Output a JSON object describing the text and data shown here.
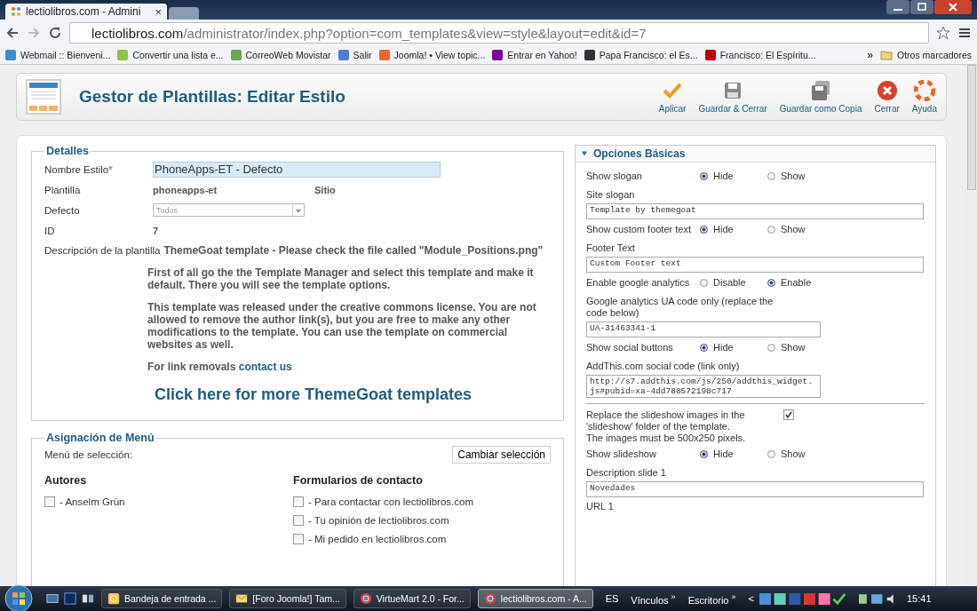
{
  "browser": {
    "tabs": [
      {
        "title": "lectiolibros.com - Admini",
        "selected": true,
        "close": "×"
      },
      {
        "selected": false
      }
    ],
    "address": {
      "host": "lectiolibros.com",
      "path": "/administrator/index.php?option=com_templates&view=style&layout=edit&id=7"
    },
    "bookmarks": [
      {
        "label": "Webmail :: Bienveni...",
        "color": "#3a8fd0"
      },
      {
        "label": "Convertir una lista e...",
        "color": "#8cc63f"
      },
      {
        "label": "CorreoWeb Movistar",
        "color": "#6aa84f"
      },
      {
        "label": "Salir",
        "color": "#4a7fd4"
      },
      {
        "label": "Joomla! • View topic...",
        "color": "#e8662a"
      },
      {
        "label": "Entrar en Yahoo!",
        "color": "#7b0099"
      },
      {
        "label": "Papa Francisco: el Es...",
        "color": "#333333"
      },
      {
        "label": "Francisco: El Espíritu...",
        "color": "#c00000"
      }
    ],
    "more": "»",
    "other_bookmarks": "Otros marcadores"
  },
  "header": {
    "title": "Gestor de Plantillas: Editar Estilo",
    "toolbar": [
      {
        "label": "Aplicar",
        "kind": "apply"
      },
      {
        "label": "Guardar & Cerrar",
        "kind": "save"
      },
      {
        "label": "Guardar como Copia",
        "kind": "copy"
      },
      {
        "label": "Cerrar",
        "kind": "close"
      },
      {
        "label": "Ayuda",
        "kind": "help"
      }
    ]
  },
  "details": {
    "legend": "Detalles",
    "fields": [
      {
        "kind": "input",
        "label": "Nombre Estilo",
        "required_mark": "*",
        "value": "PhoneApps-ET - Defecto"
      },
      {
        "kind": "static",
        "label": "Plantilla",
        "value": "phoneapps-et",
        "extra": "Sitio"
      },
      {
        "kind": "select",
        "label": "Defecto",
        "value": "Todos"
      },
      {
        "kind": "static",
        "label": "ID",
        "value": "7"
      }
    ],
    "description": {
      "label": "Descripción de la plantilla",
      "first": "ThemeGoat template - Please check the file called \"Module_Positions.png\"",
      "paragraphs": [
        "First of all go the the Template Manager and select this template and make it default. There you will see the template options.",
        "This template was released under the creative commons license. You are not allowed to remove the author link(s), but you are free to make any other modifications to the template. You can use the template on commercial websites as well."
      ],
      "link_intro": "For link removals",
      "link": "contact us",
      "big_link": "Click here for more ThemeGoat templates"
    }
  },
  "menu_assignment": {
    "legend": "Asignación de Menú",
    "selection_label": "Menú de selección:",
    "change_button": "Cambiar selección",
    "groups": [
      {
        "title": "Autores",
        "items": [
          {
            "label": "- Anselm Grün",
            "checked": false
          }
        ]
      },
      {
        "title": "Formularios de contacto",
        "items": [
          {
            "label": "- Para contactar con lectiolibros.com",
            "checked": false
          },
          {
            "label": "- Tu opinión de lectiolibros.com",
            "checked": false
          },
          {
            "label": "- Mi pedido en lectiolibros.com",
            "checked": false
          }
        ]
      }
    ]
  },
  "options": {
    "title": "Opciones Básicas",
    "expanded": true,
    "rows": [
      {
        "kind": "radio",
        "label": "Show slogan",
        "options": [
          {
            "label": "Hide",
            "selected": true
          },
          {
            "label": "Show",
            "selected": false
          }
        ]
      },
      {
        "kind": "text",
        "label": "Site slogan",
        "value": "Template by themegoat",
        "wide": true
      },
      {
        "kind": "radio",
        "label": "Show custom footer text",
        "options": [
          {
            "label": "Hide",
            "selected": true
          },
          {
            "label": "Show",
            "selected": false
          }
        ]
      },
      {
        "kind": "text",
        "label": "Footer Text",
        "value": "Custom Footer text",
        "wide": true
      },
      {
        "kind": "radio",
        "label": "Enable google analytics",
        "options": [
          {
            "label": "Disable",
            "selected": false
          },
          {
            "label": "Enable",
            "selected": true
          }
        ]
      },
      {
        "kind": "text",
        "label": "Google analytics UA code only (replace the code below)",
        "value": "UA-31463341-1",
        "wide": false
      },
      {
        "kind": "radio",
        "label": "Show social buttons",
        "options": [
          {
            "label": "Hide",
            "selected": true
          },
          {
            "label": "Show",
            "selected": false
          }
        ]
      },
      {
        "kind": "text",
        "label": "AddThis.com social code (link only)",
        "value": "http://s7.addthis.com/js/250/addthis_widget.js#pubid=xa-4dd788572198c717",
        "wide": false
      },
      {
        "kind": "divider"
      },
      {
        "kind": "checkbox",
        "label": "Replace the slideshow images in the 'slideshow' folder of the template. The images must be 500x250 pixels.",
        "checked": true
      },
      {
        "kind": "radio",
        "label": "Show slideshow",
        "options": [
          {
            "label": "Hide",
            "selected": true
          },
          {
            "label": "Show",
            "selected": false
          }
        ]
      },
      {
        "kind": "text",
        "label": "Description slide 1",
        "value": "Novedades",
        "wide": true
      },
      {
        "kind": "label",
        "label": "URL 1"
      }
    ]
  },
  "taskbar": {
    "tasks": [
      {
        "label": "Bandeja de entrada ...",
        "selected": false
      },
      {
        "label": "[Foro Joomla!] Tam...",
        "selected": false
      },
      {
        "label": "VirtueMart 2.0 - For...",
        "selected": false
      },
      {
        "label": "lectiolibros.com - A...",
        "selected": true
      }
    ],
    "language": "ES",
    "toolbars": [
      {
        "label": "Vínculos",
        "more": "»"
      },
      {
        "label": "Escritorio",
        "more": "»"
      }
    ],
    "tray_toggle": "<",
    "clock": "15:41"
  }
}
